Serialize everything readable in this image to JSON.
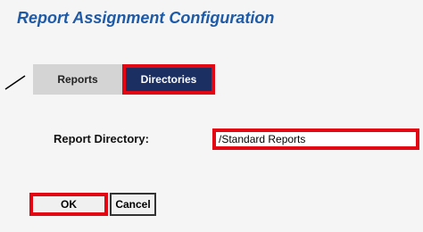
{
  "header": {
    "title": "Report Assignment Configuration"
  },
  "tabs": [
    {
      "label": "Reports",
      "selected": false
    },
    {
      "label": "Directories",
      "selected": true
    }
  ],
  "form": {
    "report_directory_label": "Report Directory:",
    "report_directory_value": "/Standard Reports"
  },
  "buttons": {
    "ok_label": "OK",
    "cancel_label": "Cancel"
  },
  "colors": {
    "title": "#1f5aa6",
    "selected_tab": "#1c2f63",
    "unselected_tab": "#d4d4d4",
    "highlight": "#e30613"
  }
}
